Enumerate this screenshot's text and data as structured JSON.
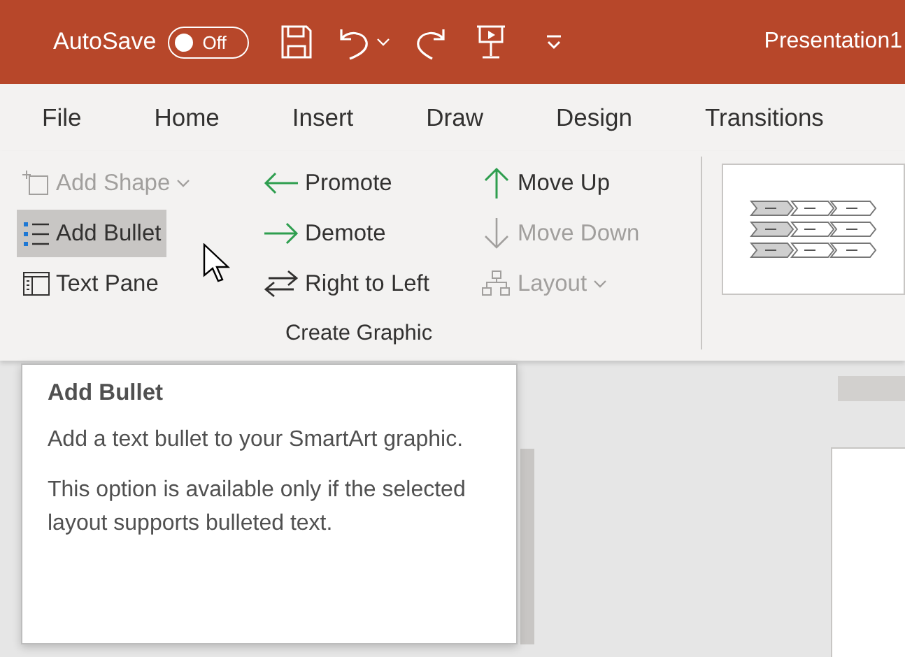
{
  "title_bar": {
    "autosave_label": "AutoSave",
    "autosave_toggle": {
      "label": "Off",
      "on": false
    },
    "title": "Presentation1"
  },
  "tabs": [
    {
      "label": "File",
      "selected": false
    },
    {
      "label": "Home",
      "selected": false
    },
    {
      "label": "Insert",
      "selected": false
    },
    {
      "label": "Draw",
      "selected": false
    },
    {
      "label": "Design",
      "selected": false
    },
    {
      "label": "Transitions",
      "selected": false
    }
  ],
  "ribbon": {
    "group_label": "Create Graphic",
    "columns": [
      [
        {
          "kind": "add-shape",
          "label": "Add Shape",
          "disabled": true,
          "highlighted": false,
          "dropdown": true
        },
        {
          "kind": "bullets",
          "label": "Add Bullet",
          "disabled": false,
          "highlighted": true,
          "dropdown": false
        },
        {
          "kind": "text-pane",
          "label": "Text Pane",
          "disabled": false,
          "highlighted": false,
          "dropdown": false
        }
      ],
      [
        {
          "kind": "arrow-left",
          "label": "Promote",
          "disabled": false,
          "highlighted": false,
          "dropdown": false
        },
        {
          "kind": "arrow-right",
          "label": "Demote",
          "disabled": false,
          "highlighted": false,
          "dropdown": false
        },
        {
          "kind": "swap",
          "label": "Right to Left",
          "disabled": false,
          "highlighted": false,
          "dropdown": false
        }
      ],
      [
        {
          "kind": "arrow-up",
          "label": "Move Up",
          "disabled": false,
          "highlighted": false,
          "dropdown": false
        },
        {
          "kind": "arrow-down",
          "label": "Move Down",
          "disabled": true,
          "highlighted": false,
          "dropdown": false
        },
        {
          "kind": "layout",
          "label": "Layout",
          "disabled": true,
          "highlighted": false,
          "dropdown": true
        }
      ]
    ]
  },
  "tooltip": {
    "title": "Add Bullet",
    "paragraphs": [
      "Add a text bullet to your SmartArt graphic.",
      "This option is available only if the selected layout supports bulleted text."
    ]
  }
}
